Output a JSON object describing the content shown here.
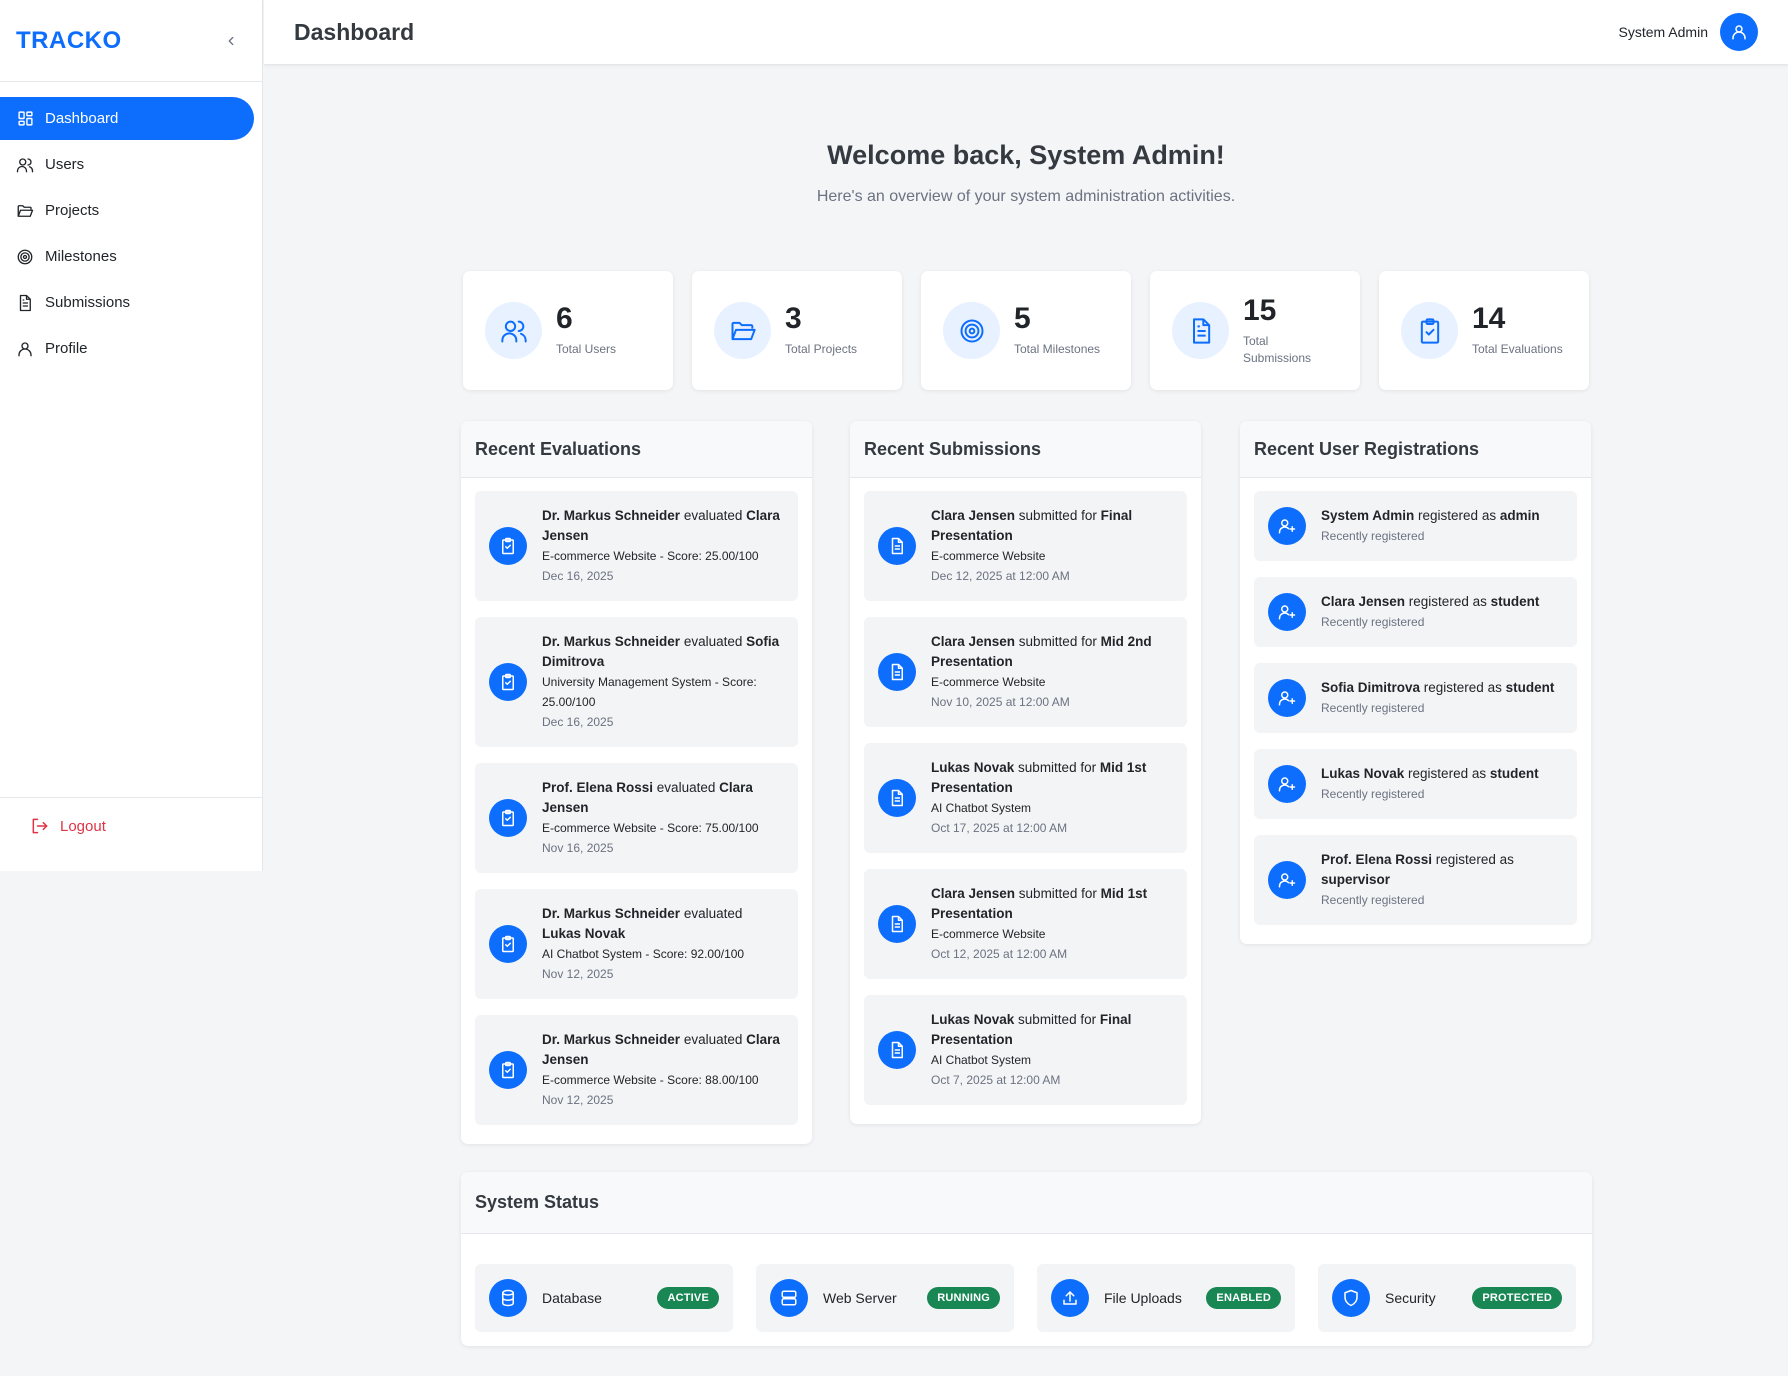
{
  "sidebar": {
    "brand": "TRACKO",
    "items": [
      {
        "label": "Dashboard",
        "icon": "dashboard-icon"
      },
      {
        "label": "Users",
        "icon": "users-icon"
      },
      {
        "label": "Projects",
        "icon": "folder-icon"
      },
      {
        "label": "Milestones",
        "icon": "target-icon"
      },
      {
        "label": "Submissions",
        "icon": "document-icon"
      },
      {
        "label": "Profile",
        "icon": "user-icon"
      }
    ],
    "logout_label": "Logout"
  },
  "header": {
    "title": "Dashboard",
    "user_name": "System Admin"
  },
  "welcome": {
    "title": "Welcome back, System Admin!",
    "subtitle": "Here's an overview of your system administration activities."
  },
  "stats": [
    {
      "value": "6",
      "label": "Total Users",
      "icon": "users-icon"
    },
    {
      "value": "3",
      "label": "Total Projects",
      "icon": "folder-icon"
    },
    {
      "value": "5",
      "label": "Total Milestones",
      "icon": "target-icon"
    },
    {
      "value": "15",
      "label": "Total Submissions",
      "icon": "document-icon"
    },
    {
      "value": "14",
      "label": "Total Evaluations",
      "icon": "clipboard-check-icon"
    }
  ],
  "evaluations": {
    "title": "Recent Evaluations",
    "items": [
      {
        "evaluator": "Dr. Markus Schneider",
        "verb": " evaluated ",
        "student": "Clara Jensen",
        "detail": "E-commerce Website - Score: 25.00/100",
        "date": "Dec 16, 2025"
      },
      {
        "evaluator": "Dr. Markus Schneider",
        "verb": " evaluated ",
        "student": "Sofia Dimitrova",
        "detail": "University Management System - Score: 25.00/100",
        "date": "Dec 16, 2025"
      },
      {
        "evaluator": "Prof. Elena Rossi",
        "verb": " evaluated ",
        "student": "Clara Jensen",
        "detail": "E-commerce Website - Score: 75.00/100",
        "date": "Nov 16, 2025"
      },
      {
        "evaluator": "Dr. Markus Schneider",
        "verb": " evaluated ",
        "student": "Lukas Novak",
        "detail": "AI Chatbot System - Score: 92.00/100",
        "date": "Nov 12, 2025"
      },
      {
        "evaluator": "Dr. Markus Schneider",
        "verb": " evaluated ",
        "student": "Clara Jensen",
        "detail": "E-commerce Website - Score: 88.00/100",
        "date": "Nov 12, 2025"
      }
    ]
  },
  "submissions": {
    "title": "Recent Submissions",
    "items": [
      {
        "student": "Clara Jensen",
        "verb": " submitted for ",
        "milestone": "Final Presentation",
        "project": "E-commerce Website",
        "date": "Dec 12, 2025 at 12:00 AM"
      },
      {
        "student": "Clara Jensen",
        "verb": " submitted for ",
        "milestone": "Mid 2nd Presentation",
        "project": "E-commerce Website",
        "date": "Nov 10, 2025 at 12:00 AM"
      },
      {
        "student": "Lukas Novak",
        "verb": " submitted for ",
        "milestone": "Mid 1st Presentation",
        "project": "AI Chatbot System",
        "date": "Oct 17, 2025 at 12:00 AM"
      },
      {
        "student": "Clara Jensen",
        "verb": " submitted for ",
        "milestone": "Mid 1st Presentation",
        "project": "E-commerce Website",
        "date": "Oct 12, 2025 at 12:00 AM"
      },
      {
        "student": "Lukas Novak",
        "verb": " submitted for ",
        "milestone": "Final Presentation",
        "project": "AI Chatbot System",
        "date": "Oct 7, 2025 at 12:00 AM"
      }
    ]
  },
  "registrations": {
    "title": "Recent User Registrations",
    "items": [
      {
        "name": "System Admin",
        "verb": " registered as ",
        "role": "admin",
        "note": "Recently registered"
      },
      {
        "name": "Clara Jensen",
        "verb": " registered as ",
        "role": "student",
        "note": "Recently registered"
      },
      {
        "name": "Sofia Dimitrova",
        "verb": " registered as ",
        "role": "student",
        "note": "Recently registered"
      },
      {
        "name": "Lukas Novak",
        "verb": " registered as ",
        "role": "student",
        "note": "Recently registered"
      },
      {
        "name": "Prof. Elena Rossi",
        "verb": " registered as ",
        "role": "supervisor",
        "note": "Recently registered"
      }
    ]
  },
  "system_status": {
    "title": "System Status",
    "items": [
      {
        "name": "Database",
        "status": "ACTIVE",
        "icon": "database-icon"
      },
      {
        "name": "Web Server",
        "status": "RUNNING",
        "icon": "server-icon"
      },
      {
        "name": "File Uploads",
        "status": "ENABLED",
        "icon": "upload-icon"
      },
      {
        "name": "Security",
        "status": "PROTECTED",
        "icon": "shield-icon"
      }
    ]
  },
  "colors": {
    "primary": "#0d6efd",
    "success": "#198754",
    "danger": "#dc3545"
  }
}
